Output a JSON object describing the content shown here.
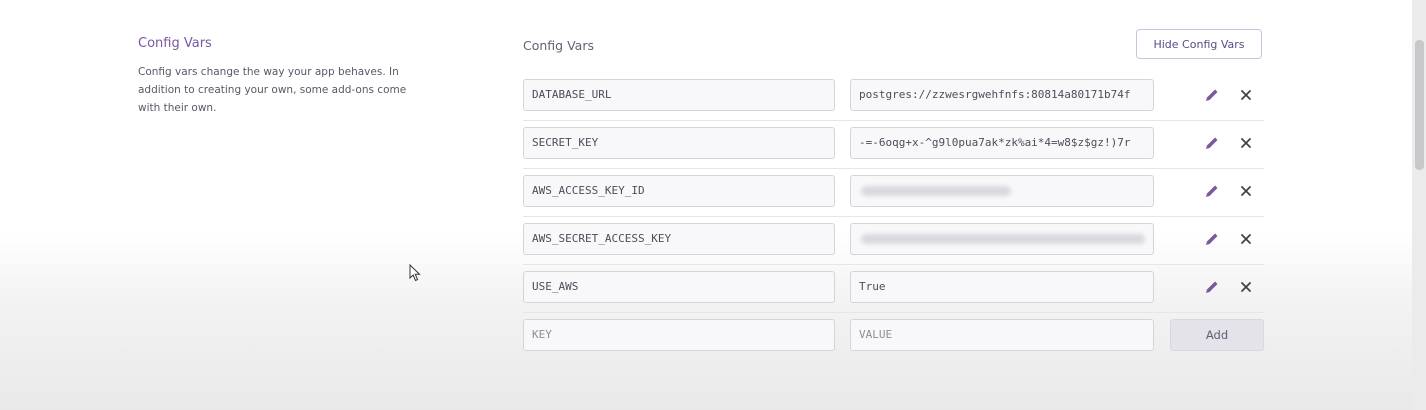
{
  "sidebar": {
    "title": "Config Vars",
    "description": "Config vars change the way your app behaves. In addition to creating your own, some add-ons come with their own."
  },
  "main": {
    "title": "Config Vars",
    "hide_button_label": "Hide Config Vars"
  },
  "rows": [
    {
      "key": "DATABASE_URL",
      "value": "postgres://zzwesrgwehfnfs:80814a80171b74f"
    },
    {
      "key": "SECRET_KEY",
      "value": "-=-6oqg+x-^g9l0pua7ak*zk%ai*4=w8$z$gz!)7r"
    },
    {
      "key": "AWS_ACCESS_KEY_ID",
      "value": ""
    },
    {
      "key": "AWS_SECRET_ACCESS_KEY",
      "value": ""
    },
    {
      "key": "USE_AWS",
      "value": "True"
    }
  ],
  "new_row": {
    "key_placeholder": "KEY",
    "value_placeholder": "VALUE",
    "add_label": "Add"
  },
  "colors": {
    "accent": "#79589f",
    "edit_icon": "#79589f",
    "delete_icon": "#3f4350"
  }
}
